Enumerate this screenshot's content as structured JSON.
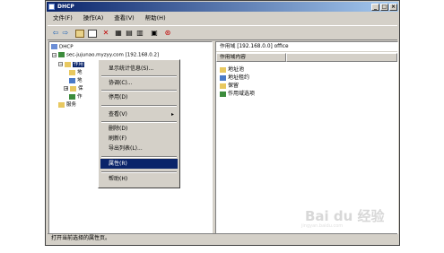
{
  "window": {
    "title": "DHCP"
  },
  "menubar": [
    {
      "label": "文件(F)"
    },
    {
      "label": "操作(A)"
    },
    {
      "label": "查看(V)"
    },
    {
      "label": "帮助(H)"
    }
  ],
  "toolbar": {
    "back_icon": "back-arrow-icon",
    "forward_icon": "forward-arrow-icon"
  },
  "tree": {
    "root": "DHCP",
    "server": "sec-jujunao.myzyy.com [192.168.0.2]",
    "scope": "作用",
    "sub1": "地",
    "sub2": "地",
    "sub3": "保",
    "sub4": "作",
    "server_options": "服务"
  },
  "right_pane": {
    "header": "作用域 [192.168.0.0] office",
    "column": "作用域内容",
    "items": [
      "地址池",
      "地址租约",
      "保留",
      "作用域选项"
    ]
  },
  "context_menu": {
    "items": [
      {
        "label": "显示统计信息(S)..."
      },
      {
        "label": "协调(C)..."
      },
      {
        "label": "停用(D)"
      },
      {
        "label": "查看(V)"
      },
      {
        "label": "删除(D)"
      },
      {
        "label": "刷新(F)"
      },
      {
        "label": "导出列表(L)..."
      },
      {
        "label": "属性(R)"
      },
      {
        "label": "帮助(H)"
      }
    ]
  },
  "status": "打开当前选择的属性页。",
  "watermark": {
    "text": "Bai du 经验",
    "sub": "jingyan.baidu.com"
  }
}
